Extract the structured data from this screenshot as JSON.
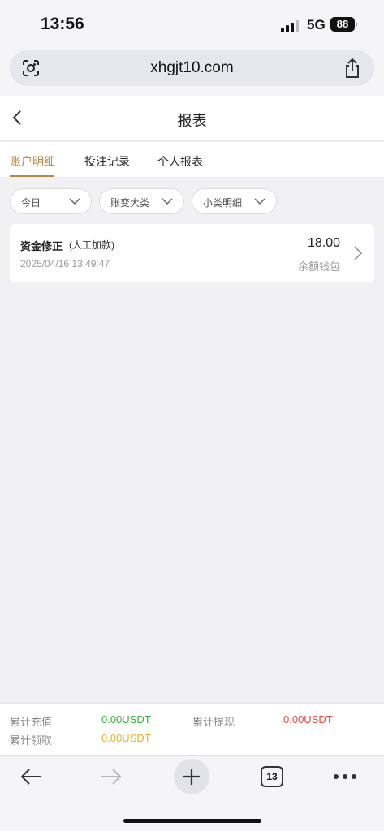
{
  "status_bar": {
    "time": "13:56",
    "network": "5G",
    "battery": "88"
  },
  "browser": {
    "url": "xhgjt10.com",
    "tabs_count": "13"
  },
  "header": {
    "title": "报表"
  },
  "tabs": [
    {
      "label": "账户明细",
      "active": true
    },
    {
      "label": "投注记录",
      "active": false
    },
    {
      "label": "个人报表",
      "active": false
    }
  ],
  "filters": [
    {
      "label": "今日"
    },
    {
      "label": "账变大类"
    },
    {
      "label": "小类明细"
    }
  ],
  "records": [
    {
      "title": "资金修正",
      "subtitle": "(人工加款)",
      "time": "2025/04/16 13:49:47",
      "amount": "18.00",
      "wallet": "余额钱包"
    }
  ],
  "summary": {
    "recharge_label": "累计充值",
    "recharge_value": "0.00USDT",
    "withdraw_label": "累计提现",
    "withdraw_value": "0.00USDT",
    "claim_label": "累计领取",
    "claim_value": "0.00USDT"
  },
  "colors": {
    "accent": "#b08a4c",
    "green": "#32b035",
    "red": "#e0463f",
    "yellow": "#e8b21f"
  }
}
